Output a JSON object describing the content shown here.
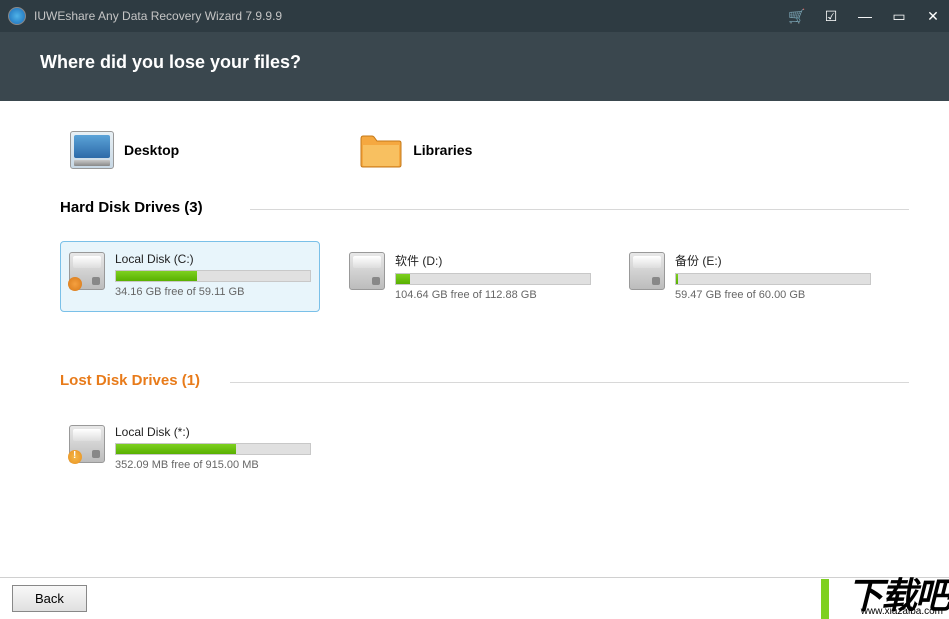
{
  "titlebar": {
    "title": "IUWEshare Any Data Recovery Wizard 7.9.9.9"
  },
  "header": {
    "question": "Where did you lose your files?"
  },
  "shortcuts": {
    "desktop": "Desktop",
    "libraries": "Libraries"
  },
  "sections": {
    "hard_title": "Hard Disk Drives (3)",
    "lost_title": "Lost Disk Drives (1)"
  },
  "drives": {
    "hard": [
      {
        "name": "Local Disk (C:)",
        "free": "34.16 GB free of 59.11 GB",
        "fill": 42,
        "selected": true,
        "badge": "win"
      },
      {
        "name": "软件 (D:)",
        "free": "104.64 GB free of 112.88 GB",
        "fill": 7,
        "selected": false,
        "badge": ""
      },
      {
        "name": "备份 (E:)",
        "free": "59.47 GB free of 60.00 GB",
        "fill": 1,
        "selected": false,
        "badge": ""
      }
    ],
    "lost": [
      {
        "name": "Local Disk (*:)",
        "free": "352.09 MB free of 915.00 MB",
        "fill": 62,
        "selected": false,
        "badge": "warn"
      }
    ]
  },
  "footer": {
    "back": "Back"
  },
  "watermark": {
    "text": "下载吧",
    "url": "www.xiazaiba.com"
  }
}
